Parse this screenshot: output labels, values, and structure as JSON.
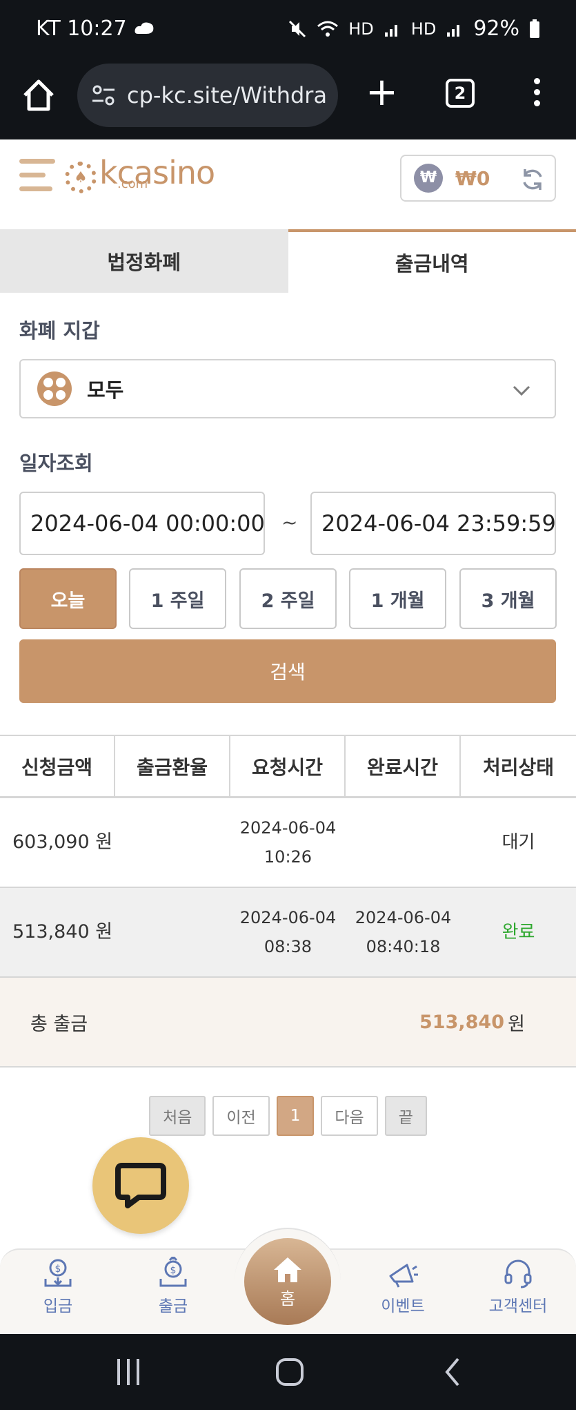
{
  "status_bar": {
    "carrier_time": "KT 10:27",
    "battery": "92%",
    "icons": [
      "mute-icon",
      "wifi-icon",
      "hd-icon",
      "signal-icon",
      "battery-icon"
    ]
  },
  "browser": {
    "url": "cp-kc.site/Withdra",
    "tab_count": "2"
  },
  "header": {
    "logo_text": "kcasino",
    "logo_sub": ".com",
    "balance_symbol": "₩",
    "balance": "₩0"
  },
  "tabs": [
    {
      "label": "법정화폐",
      "active": false
    },
    {
      "label": "출금내역",
      "active": true
    }
  ],
  "wallet": {
    "label": "화폐 지갑",
    "value": "모두"
  },
  "date_search": {
    "label": "일자조회",
    "from": "2024-06-04 00:00:00",
    "separator": "~",
    "to": "2024-06-04 23:59:59",
    "ranges": [
      "오늘",
      "1 주일",
      "2 주일",
      "1 개월",
      "3 개월"
    ],
    "active_range": "오늘",
    "search_label": "검색"
  },
  "table": {
    "headers": [
      "신청금액",
      "출금환율",
      "요청시간",
      "완료시간",
      "처리상태"
    ],
    "rows": [
      {
        "amount": "603,090 원",
        "rate": "",
        "req_date": "2024-06-04",
        "req_time": "10:26",
        "done_date": "",
        "done_time": "",
        "status": "대기"
      },
      {
        "amount": "513,840 원",
        "rate": "",
        "req_date": "2024-06-04",
        "req_time": "08:38",
        "done_date": "2024-06-04",
        "done_time": "08:40:18",
        "status": "완료"
      }
    ],
    "total_label": "총 출금",
    "total_value": "513,840",
    "total_unit": "원"
  },
  "pagination": {
    "first": "처음",
    "prev": "이전",
    "current": "1",
    "next": "다음",
    "last": "끝"
  },
  "bottom_nav": {
    "deposit": "입금",
    "withdraw": "출금",
    "home": "홈",
    "event": "이벤트",
    "support": "고객센터"
  },
  "colors": {
    "accent": "#c8956a",
    "done": "#2fa82f",
    "chat": "#e9c578"
  }
}
